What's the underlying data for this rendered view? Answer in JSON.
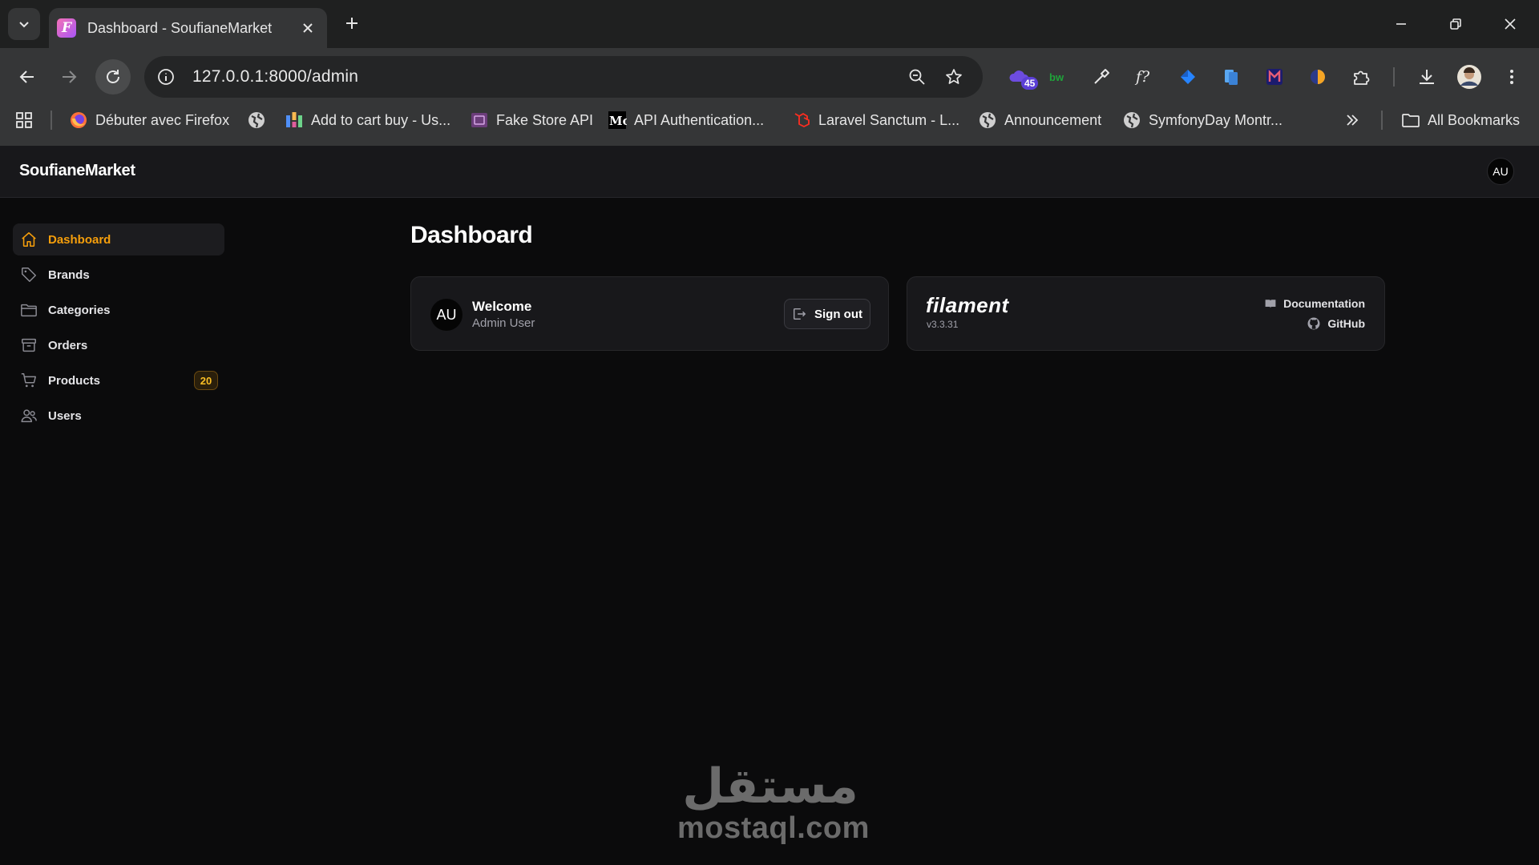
{
  "browser": {
    "tab_title": "Dashboard - SoufianeMarket",
    "url": "127.0.0.1:8000/admin",
    "extension_badge": "45",
    "bookmarks": [
      {
        "label": "Débuter avec Firefox"
      },
      {
        "label": ""
      },
      {
        "label": "Add to cart buy - Us..."
      },
      {
        "label": "Fake Store API"
      },
      {
        "label": "API Authentication..."
      },
      {
        "label": "Laravel Sanctum - L..."
      },
      {
        "label": "Announcement"
      },
      {
        "label": "SymfonyDay Montr..."
      }
    ],
    "all_bookmarks": "All Bookmarks"
  },
  "app": {
    "brand": "SoufianeMarket",
    "user_initials": "AU"
  },
  "sidebar": {
    "items": [
      {
        "label": "Dashboard",
        "icon": "home-icon",
        "active": true
      },
      {
        "label": "Brands",
        "icon": "tag-icon"
      },
      {
        "label": "Categories",
        "icon": "folder-icon"
      },
      {
        "label": "Orders",
        "icon": "archive-icon"
      },
      {
        "label": "Products",
        "icon": "cart-icon",
        "badge": "20"
      },
      {
        "label": "Users",
        "icon": "users-icon"
      }
    ]
  },
  "main": {
    "title": "Dashboard",
    "welcome_card": {
      "initials": "AU",
      "heading": "Welcome",
      "user_name": "Admin User",
      "signout_label": "Sign out"
    },
    "filament_card": {
      "logo": "filament",
      "version": "v3.3.31",
      "documentation": "Documentation",
      "github": "GitHub"
    }
  },
  "watermark": {
    "arabic": "مستقل",
    "latin": "mostaql.com"
  },
  "colors": {
    "accent": "#f59e0b",
    "background": "#0b0b0c",
    "card": "#18181b"
  }
}
